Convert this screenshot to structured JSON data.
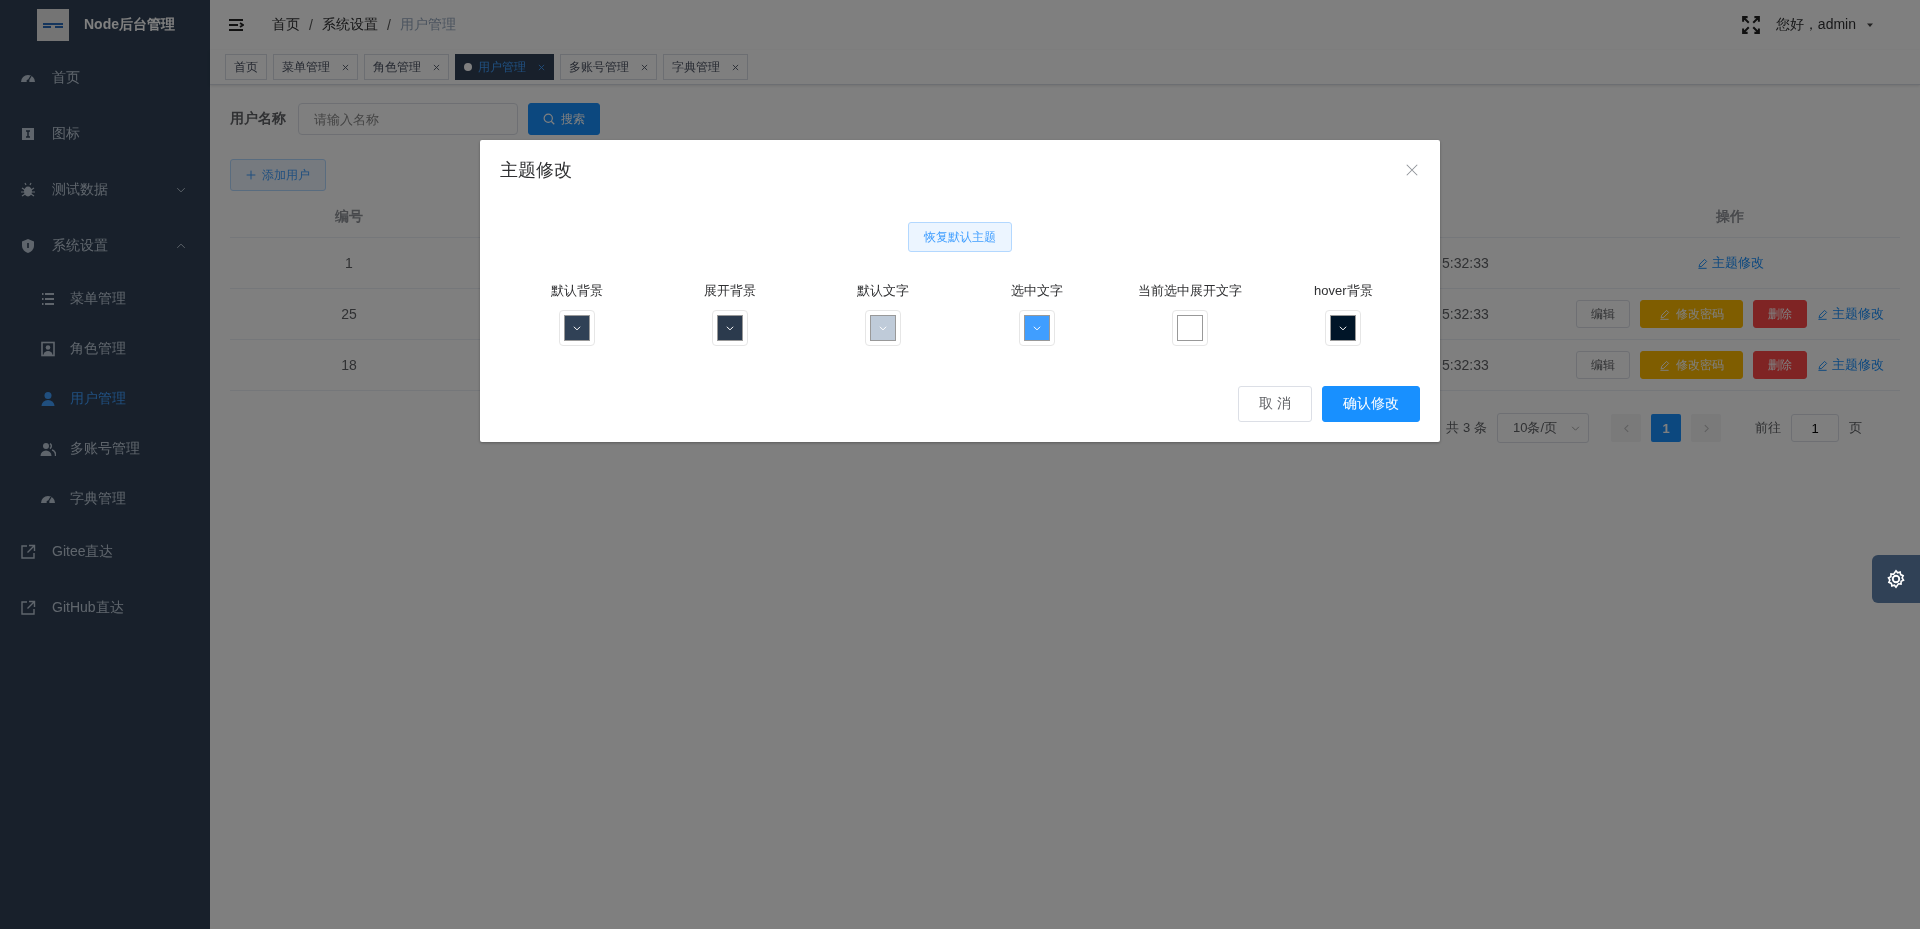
{
  "sidebar": {
    "title": "Node后台管理",
    "items": [
      {
        "label": "首页",
        "selected": false
      },
      {
        "label": "图标",
        "selected": false
      },
      {
        "label": "测试数据",
        "selected": false,
        "expanded": false
      },
      {
        "label": "系统设置",
        "selected": false,
        "expanded": true,
        "children": [
          {
            "label": "菜单管理",
            "selected": false
          },
          {
            "label": "角色管理",
            "selected": false
          },
          {
            "label": "用户管理",
            "selected": true
          },
          {
            "label": "多账号管理",
            "selected": false
          },
          {
            "label": "字典管理",
            "selected": false
          }
        ]
      },
      {
        "label": "Gitee直达",
        "selected": false
      },
      {
        "label": "GitHub直达",
        "selected": false
      }
    ]
  },
  "header": {
    "breadcrumb": [
      "首页",
      "系统设置",
      "用户管理"
    ],
    "separator": "/",
    "greeting": "您好，admin"
  },
  "tabs": [
    {
      "label": "首页",
      "closable": false,
      "selected": false
    },
    {
      "label": "菜单管理",
      "closable": true,
      "selected": false
    },
    {
      "label": "角色管理",
      "closable": true,
      "selected": false
    },
    {
      "label": "用户管理",
      "closable": true,
      "selected": true
    },
    {
      "label": "多账号管理",
      "closable": true,
      "selected": false
    },
    {
      "label": "字典管理",
      "closable": true,
      "selected": false
    }
  ],
  "search": {
    "label": "用户名称",
    "placeholder": "请输入名称",
    "button": "搜索"
  },
  "add_button": "添加用户",
  "table": {
    "columns": [
      "编号",
      "操作"
    ],
    "rows": [
      {
        "id": "1",
        "time": "5:32:33",
        "actions": [
          {
            "kind": "theme",
            "label": "主题修改"
          }
        ]
      },
      {
        "id": "25",
        "time": "5:32:33",
        "actions": [
          {
            "kind": "edit",
            "label": "编辑"
          },
          {
            "kind": "password",
            "label": "修改密码"
          },
          {
            "kind": "delete",
            "label": "删除"
          },
          {
            "kind": "theme",
            "label": "主题修改"
          }
        ]
      },
      {
        "id": "18",
        "time": "5:32:33",
        "actions": [
          {
            "kind": "edit",
            "label": "编辑"
          },
          {
            "kind": "password",
            "label": "修改密码"
          },
          {
            "kind": "delete",
            "label": "删除"
          },
          {
            "kind": "theme",
            "label": "主题修改"
          }
        ]
      }
    ]
  },
  "pagination": {
    "total": "共 3 条",
    "page_size": "10条/页",
    "pages": [
      {
        "label": "1",
        "selected": true
      }
    ],
    "goto_label": "前往",
    "goto_value": "1",
    "goto_suffix": "页"
  },
  "dialog": {
    "title": "主题修改",
    "reset_button": "恢复默认主题",
    "swatches": [
      {
        "label": "默认背景",
        "color": "#304156"
      },
      {
        "label": "展开背景",
        "color": "#2b3a4d"
      },
      {
        "label": "默认文字",
        "color": "#bfcbd9"
      },
      {
        "label": "选中文字",
        "color": "#409eff"
      },
      {
        "label": "当前选中展开文字",
        "color": "#ffffff"
      },
      {
        "label": "hover背景",
        "color": "#001528"
      }
    ],
    "buttons": [
      {
        "kind": "cancel",
        "label": "取 消"
      },
      {
        "kind": "confirm",
        "label": "确认修改"
      }
    ]
  }
}
